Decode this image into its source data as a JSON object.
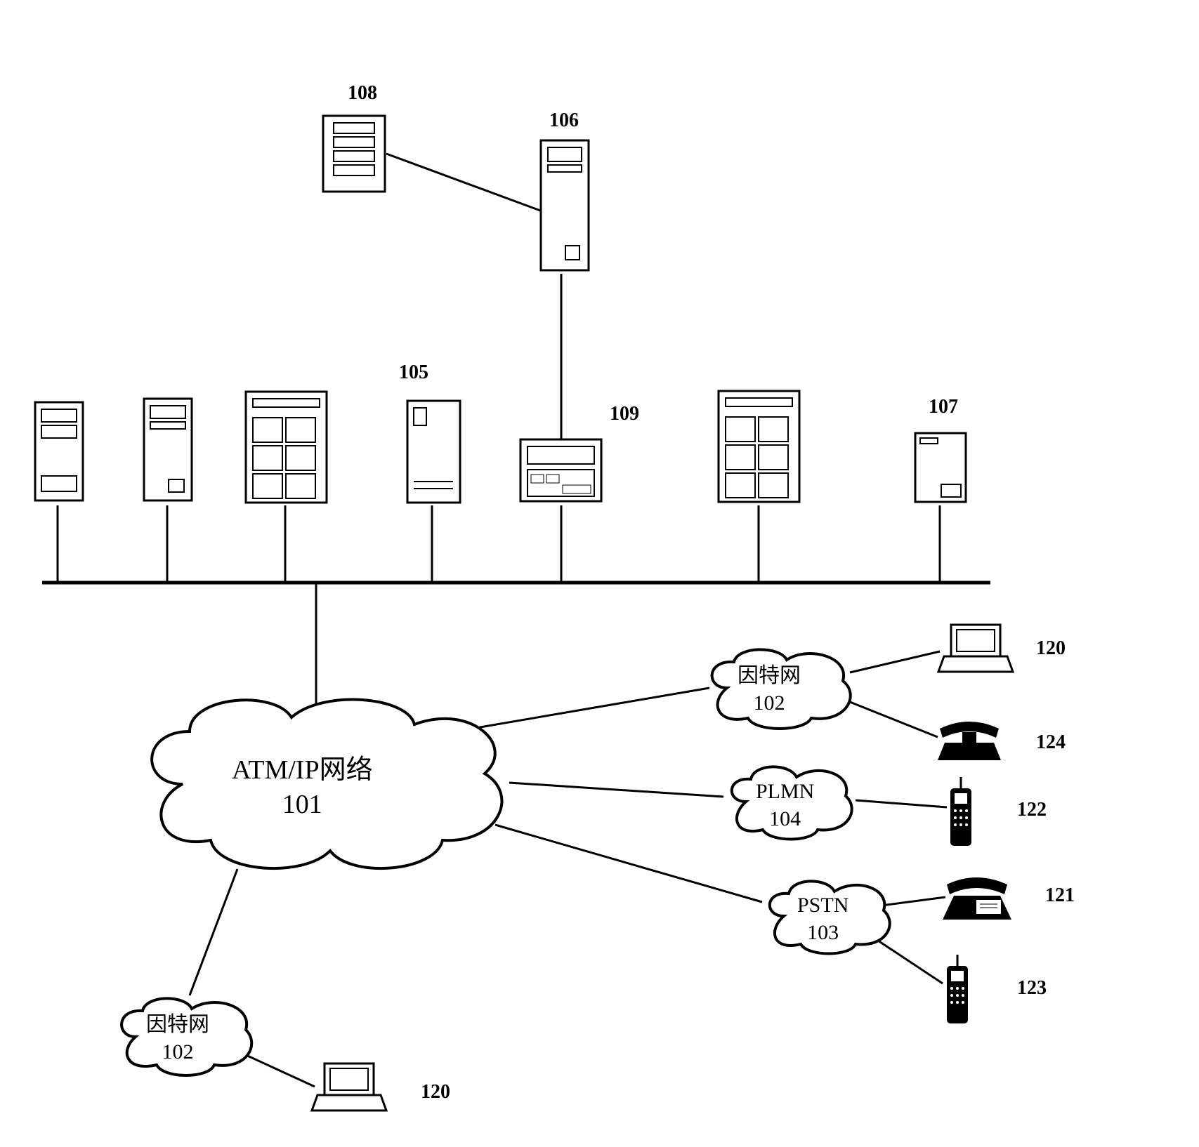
{
  "diagram": {
    "labels": {
      "l108": "108",
      "l106": "106",
      "l105": "105",
      "l109": "109",
      "l107": "107",
      "l120a": "120",
      "l124": "124",
      "l122": "122",
      "l121": "121",
      "l123": "123",
      "l120b": "120"
    },
    "clouds": {
      "atm": {
        "line1": "ATM/IP网络",
        "line2": "101"
      },
      "internet1": {
        "line1": "因特网",
        "line2": "102"
      },
      "internet2": {
        "line1": "因特网",
        "line2": "102"
      },
      "plmn": {
        "line1": "PLMN",
        "line2": "104"
      },
      "pstn": {
        "line1": "PSTN",
        "line2": "103"
      }
    }
  }
}
